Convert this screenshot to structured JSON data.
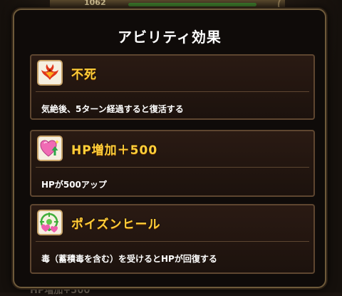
{
  "background": {
    "hp_value": "1062",
    "bottom_text": "HP増加+500"
  },
  "dialog": {
    "title": "アビリティ効果",
    "abilities": [
      {
        "name": "不死",
        "description": "気絶後、5ターン経過すると復活する",
        "icon": "phoenix-icon"
      },
      {
        "name": "HP増加＋500",
        "description": "HPが500アップ",
        "icon": "pink-heart-arrow-icon"
      },
      {
        "name": "ポイズンヒール",
        "description": "毒（蓄積毒を含む）を受けるとHPが回復する",
        "icon": "poison-heal-icon"
      }
    ]
  },
  "colors": {
    "name_text": "#ffcf3a",
    "description_text": "#ffffff",
    "card_border": "#5e4630",
    "dialog_background": "#0f0b09"
  }
}
